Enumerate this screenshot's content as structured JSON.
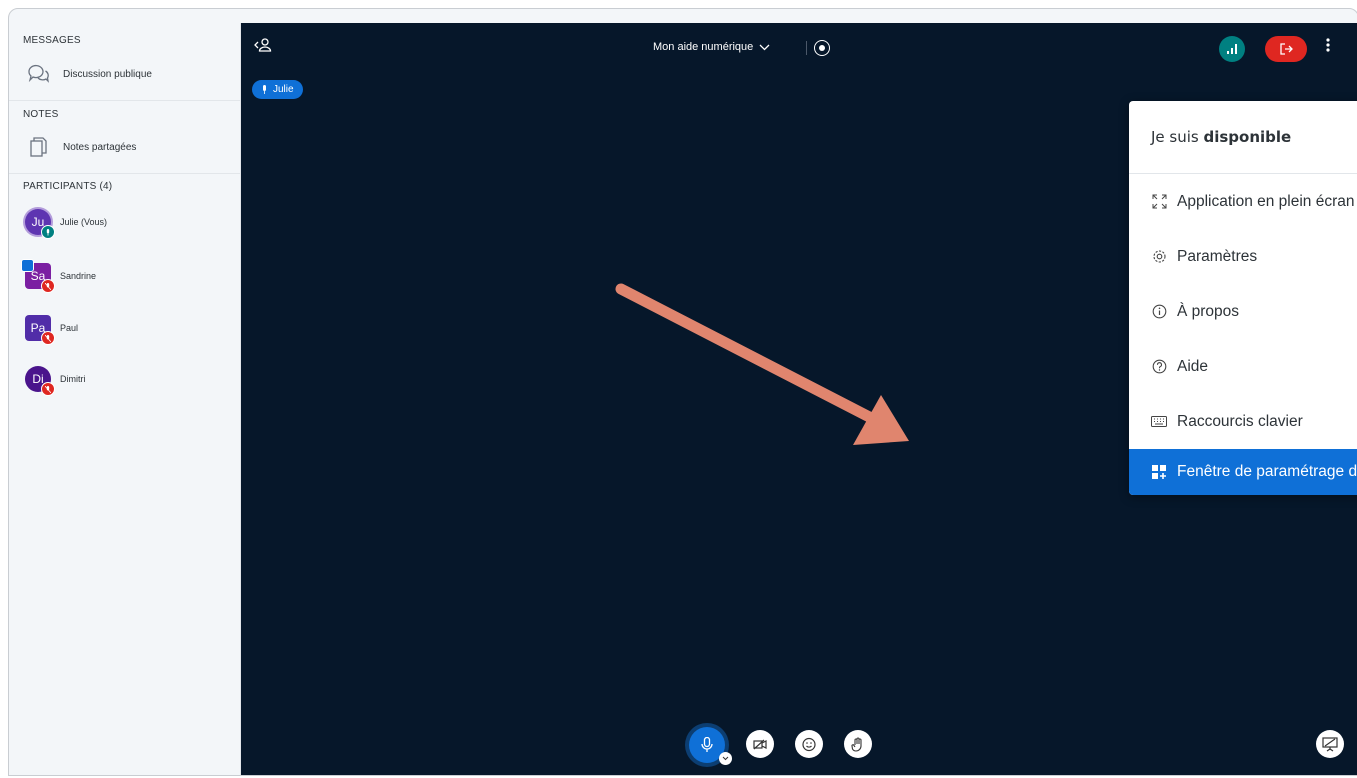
{
  "sidebar": {
    "messages_title": "MESSAGES",
    "public_chat_label": "Discussion publique",
    "notes_title": "NOTES",
    "shared_notes_label": "Notes partagées",
    "participants_title": "PARTICIPANTS (4)",
    "participants": [
      {
        "initials": "Ju",
        "name": "Julie (Vous)",
        "color": "#5e35b1",
        "shape": "round",
        "mic": "on"
      },
      {
        "initials": "Sa",
        "name": "Sandrine",
        "color": "#7b1fa2",
        "shape": "square",
        "mic": "muted",
        "presenter": true
      },
      {
        "initials": "Pa",
        "name": "Paul",
        "color": "#512da8",
        "shape": "square",
        "mic": "muted"
      },
      {
        "initials": "Di",
        "name": "Dimitri",
        "color": "#4a148c",
        "shape": "round",
        "mic": "muted"
      }
    ]
  },
  "header": {
    "talker": "Julie",
    "meeting_title": "Mon aide numérique"
  },
  "menu": {
    "status_prefix": "Je suis ",
    "status_bold": "disponible",
    "items": [
      {
        "label": "Application en plein écran",
        "icon": "fullscreen-icon"
      },
      {
        "label": "Paramètres",
        "icon": "settings-gear-icon"
      },
      {
        "label": "À propos",
        "icon": "info-icon"
      },
      {
        "label": "Aide",
        "icon": "help-icon"
      },
      {
        "label": "Raccourcis clavier",
        "icon": "keyboard-icon"
      },
      {
        "label": "Fenêtre de paramétrage de la mise en page",
        "icon": "layout-icon"
      }
    ]
  },
  "colors": {
    "accent": "#0f70d7",
    "leave": "#df2721",
    "connection": "#008081",
    "annotation_arrow": "#e0856e",
    "main_bg": "#06172a"
  }
}
